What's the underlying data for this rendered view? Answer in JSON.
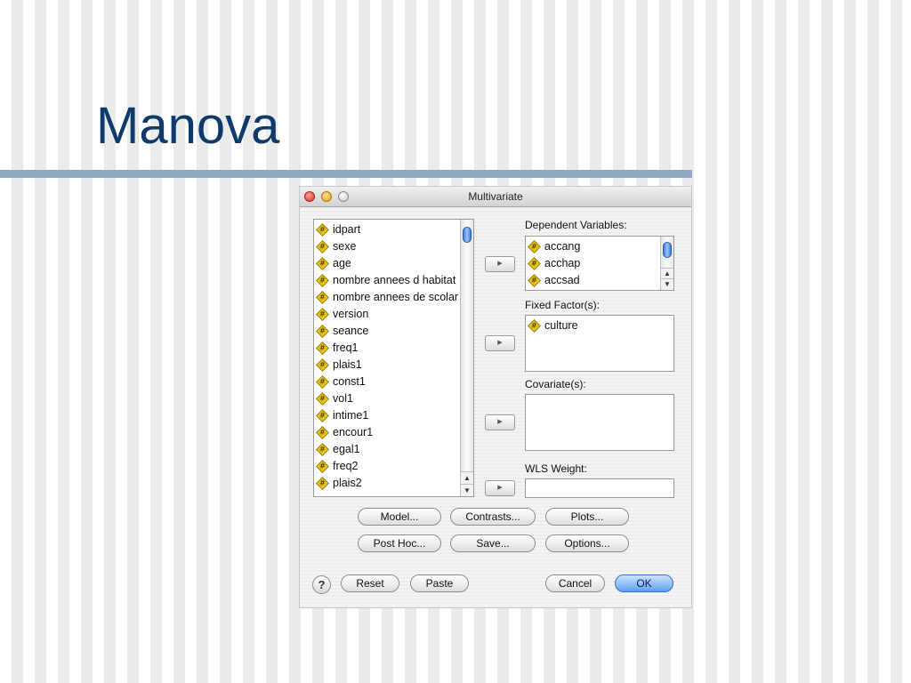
{
  "slide": {
    "title": "Manova"
  },
  "dialog": {
    "title": "Multivariate",
    "source_variables": [
      "idpart",
      "sexe",
      "age",
      "nombre annees d habitat",
      "nombre annees de scolar",
      "version",
      "seance",
      "freq1",
      "plais1",
      "const1",
      "vol1",
      "intime1",
      "encour1",
      "egal1",
      "freq2",
      "plais2"
    ],
    "dependent": {
      "label": "Dependent Variables:",
      "items": [
        "accang",
        "acchap",
        "accsad"
      ]
    },
    "fixed": {
      "label": "Fixed Factor(s):",
      "items": [
        "culture"
      ]
    },
    "covariate": {
      "label": "Covariate(s):",
      "items": []
    },
    "wls": {
      "label": "WLS Weight:",
      "value": ""
    },
    "buttons": {
      "model": "Model...",
      "contrasts": "Contrasts...",
      "plots": "Plots...",
      "posthoc": "Post Hoc...",
      "save": "Save...",
      "options": "Options...",
      "reset": "Reset",
      "paste": "Paste",
      "cancel": "Cancel",
      "ok": "OK",
      "help": "?",
      "move_arrow": "▶"
    },
    "scroll_arrows": {
      "up": "▲",
      "down": "▼"
    }
  }
}
